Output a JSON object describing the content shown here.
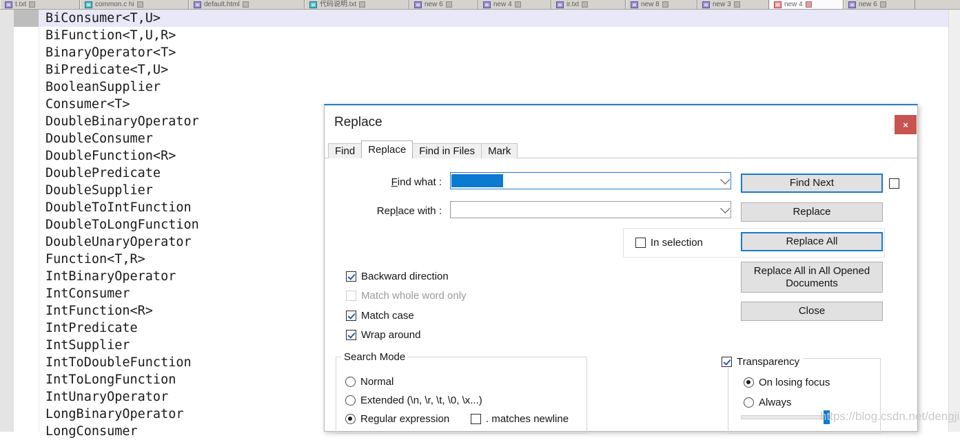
{
  "editor": {
    "tabs": [
      {
        "label": "t.txt",
        "icon": "document-icon",
        "color": "purple",
        "active": false
      },
      {
        "label": "common.c  hi",
        "icon": "document-icon",
        "color": "teal",
        "active": false
      },
      {
        "label": "default.html",
        "icon": "document-icon",
        "color": "purple",
        "active": false
      },
      {
        "label": "代码说明.txt",
        "icon": "document-icon",
        "color": "teal",
        "active": false
      },
      {
        "label": "new  6",
        "icon": "document-icon",
        "color": "purple",
        "active": false
      },
      {
        "label": "new  4",
        "icon": "document-icon",
        "color": "purple",
        "active": false
      },
      {
        "label": "ir.txt",
        "icon": "document-icon",
        "color": "purple",
        "active": false
      },
      {
        "label": "new  8",
        "icon": "document-icon",
        "color": "purple",
        "active": false
      },
      {
        "label": "new  3",
        "icon": "document-icon",
        "color": "purple",
        "active": false
      },
      {
        "label": "new  4",
        "icon": "document-icon",
        "color": "red",
        "active": true
      },
      {
        "label": "new  6",
        "icon": "document-icon",
        "color": "purple",
        "active": false
      }
    ],
    "lines": [
      "BiConsumer<T,U>",
      "BiFunction<T,U,R>",
      "BinaryOperator<T>",
      "BiPredicate<T,U>",
      "BooleanSupplier",
      "Consumer<T>",
      "DoubleBinaryOperator",
      "DoubleConsumer",
      "DoubleFunction<R>",
      "DoublePredicate",
      "DoubleSupplier",
      "DoubleToIntFunction",
      "DoubleToLongFunction",
      "DoubleUnaryOperator",
      "Function<T,R>",
      "IntBinaryOperator",
      "IntConsumer",
      "IntFunction<R>",
      "IntPredicate",
      "IntSupplier",
      "IntToDoubleFunction",
      "IntToLongFunction",
      "IntUnaryOperator",
      "LongBinaryOperator",
      "LongConsumer"
    ],
    "highlighted_line_index": 0
  },
  "dialog": {
    "title": "Replace",
    "close_label": "×",
    "tabs": [
      {
        "label": "Find",
        "active": false
      },
      {
        "label": "Replace",
        "active": true
      },
      {
        "label": "Find in Files",
        "active": false
      },
      {
        "label": "Mark",
        "active": false
      }
    ],
    "find_what": {
      "label_pre": "F",
      "label_mid": "ind what :",
      "value": "",
      "has_selection_block": true
    },
    "replace_with": {
      "label_pre_a": "Rep",
      "label_mid": "l",
      "label_pre_b": "ace with :",
      "value": ""
    },
    "buttons": {
      "find_next": "Find Next",
      "replace": "Replace",
      "replace_all": "Replace All",
      "replace_all_opened": "Replace All in All Opened Documents",
      "close": "Close"
    },
    "in_selection": {
      "label": "In selection",
      "checked": false
    },
    "find_next_side_checkbox": {
      "checked": false
    },
    "options": [
      {
        "label": "Backward direction",
        "checked": true,
        "disabled": false
      },
      {
        "label": "Match whole word only",
        "checked": false,
        "disabled": true
      },
      {
        "label": "Match case",
        "checked": true,
        "disabled": false
      },
      {
        "label": "Wrap around",
        "checked": true,
        "disabled": false
      }
    ],
    "search_mode": {
      "title": "Search Mode",
      "options": [
        {
          "label": "Normal",
          "selected": false
        },
        {
          "label": "Extended (\\n, \\r, \\t, \\0, \\x...)",
          "selected": false
        },
        {
          "label": "Regular expression",
          "selected": true
        }
      ],
      "dot_matches_newline": {
        "label": ". matches newline",
        "checked": false
      }
    },
    "transparency": {
      "label": "Transparency",
      "checked": true,
      "options": [
        {
          "label": "On losing focus",
          "selected": true
        },
        {
          "label": "Always",
          "selected": false
        }
      ],
      "slider_value": 100
    }
  },
  "watermark": "https://blog.csdn.net/dengjili",
  "colors": {
    "accent": "#1878cf",
    "selection": "#0c7ad1",
    "close_button": "#c9534f",
    "line_highlight": "#e8e8f8"
  }
}
